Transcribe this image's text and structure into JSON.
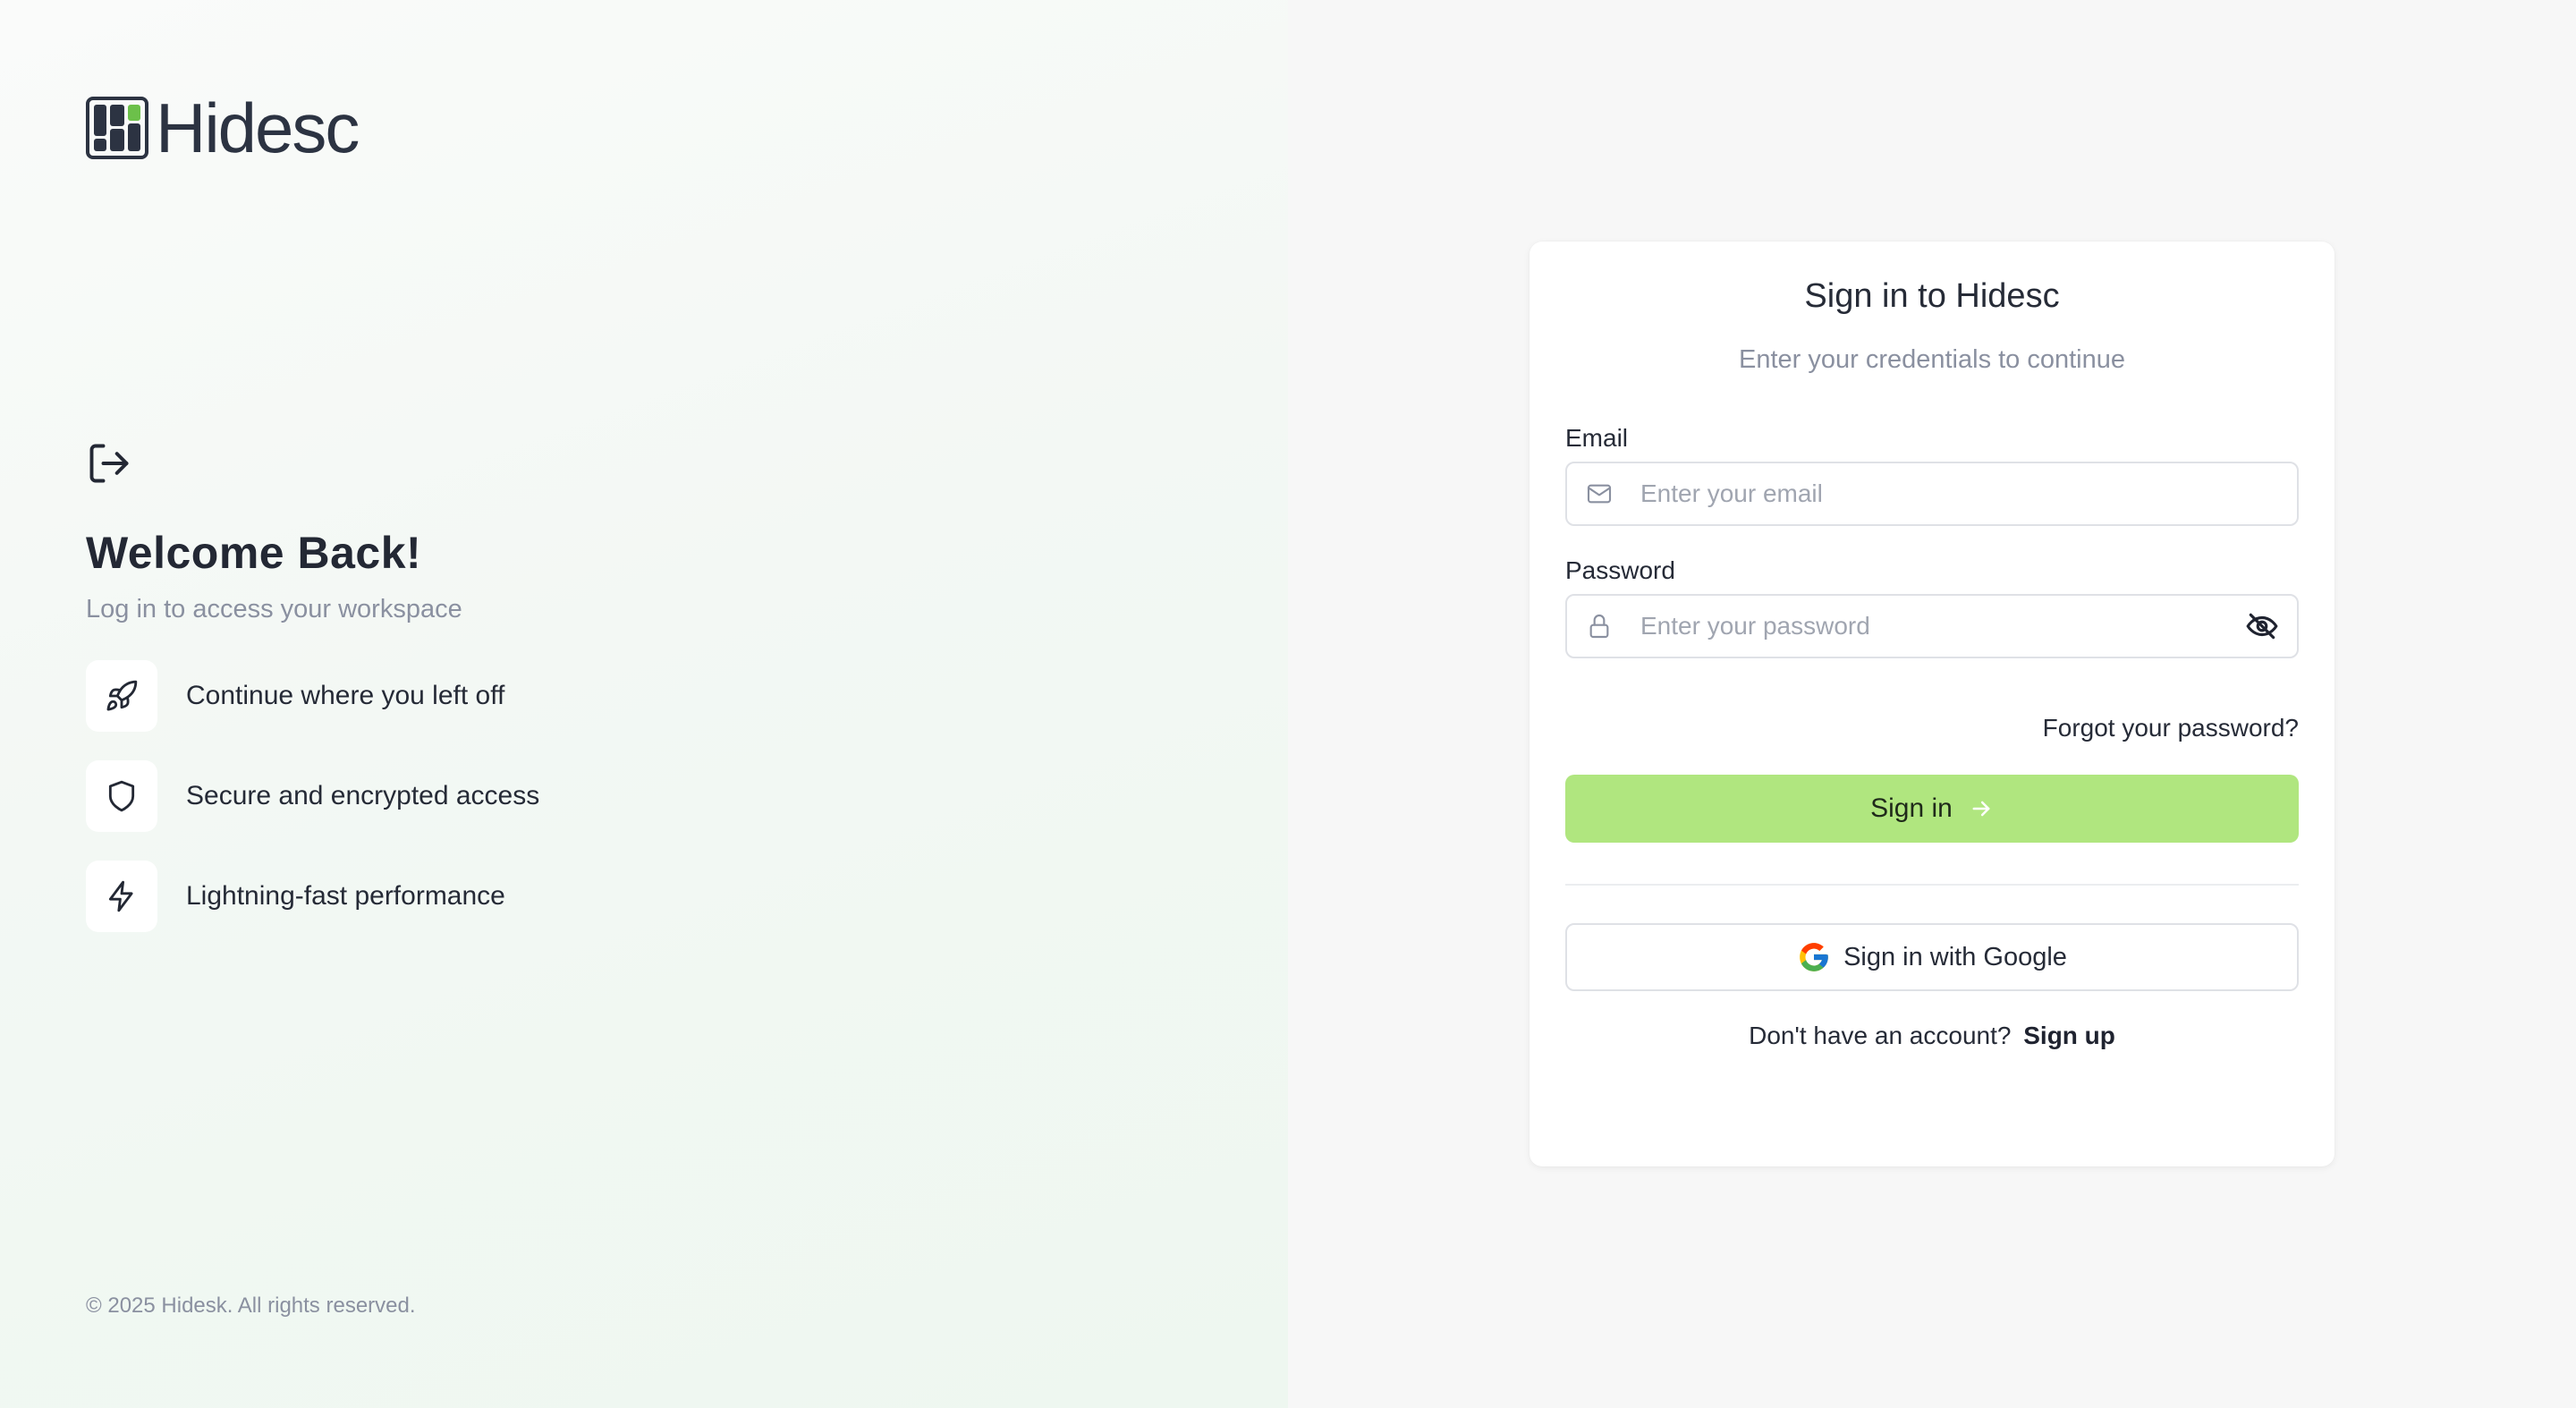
{
  "brand": {
    "name": "Hidesc",
    "accent": "#6cc04a"
  },
  "hero": {
    "icon": "log-in-icon",
    "title": "Welcome Back!",
    "subtitle": "Log in to access your workspace"
  },
  "features": [
    {
      "icon": "rocket-icon",
      "label": "Continue where you left off"
    },
    {
      "icon": "shield-icon",
      "label": "Secure and encrypted access"
    },
    {
      "icon": "lightning-icon",
      "label": "Lightning-fast performance"
    }
  ],
  "footer": {
    "copyright": "© 2025 Hidesk. All rights reserved."
  },
  "signin": {
    "title": "Sign in to Hidesc",
    "subtitle": "Enter your credentials to continue",
    "email": {
      "label": "Email",
      "placeholder": "Enter your email",
      "value": ""
    },
    "password": {
      "label": "Password",
      "placeholder": "Enter your password",
      "value": ""
    },
    "forgot_label": "Forgot your password?",
    "submit_label": "Sign in",
    "submit_color": "#b0e67f",
    "google_label": "Sign in with Google",
    "signup_prompt": "Don't have an account?",
    "signup_link": "Sign up"
  }
}
